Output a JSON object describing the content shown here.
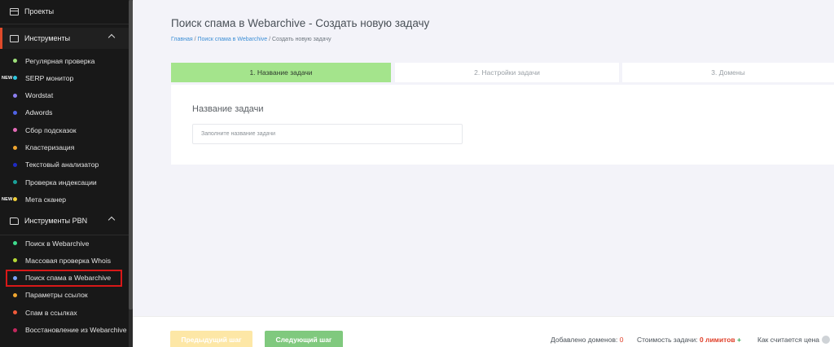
{
  "sidebar": {
    "top_item": "Проекты",
    "sections": [
      {
        "label": "Инструменты"
      },
      {
        "label": "Инструменты PBN"
      }
    ],
    "tools": [
      {
        "label": "Регулярная проверка",
        "dot": "#9ee17a",
        "new": ""
      },
      {
        "label": "SERP монитор",
        "dot": "#2ec8e0",
        "new": "NEW"
      },
      {
        "label": "Wordstat",
        "dot": "#8d7ff0",
        "new": ""
      },
      {
        "label": "Adwords",
        "dot": "#4f63e6",
        "new": ""
      },
      {
        "label": "Сбор подсказок",
        "dot": "#e46bb7",
        "new": ""
      },
      {
        "label": "Кластеризация",
        "dot": "#f0a630",
        "new": ""
      },
      {
        "label": "Текстовый анализатор",
        "dot": "#1f2bc4",
        "new": ""
      },
      {
        "label": "Проверка индексации",
        "dot": "#1aa19a",
        "new": ""
      },
      {
        "label": "Мета сканер",
        "dot": "#f2d13a",
        "new": "NEW"
      }
    ],
    "pbn_tools": [
      {
        "label": "Поиск в Webarchive",
        "dot": "#3fdc8d"
      },
      {
        "label": "Массовая проверка Whois",
        "dot": "#b5d936"
      },
      {
        "label": "Поиск спама в Webarchive",
        "dot": "#7aa2f7"
      },
      {
        "label": "Параметры ссылок",
        "dot": "#f0a630"
      },
      {
        "label": "Спам в ссылках",
        "dot": "#f05a3a"
      },
      {
        "label": "Восстановление из Webarchive",
        "dot": "#c4285e"
      }
    ]
  },
  "header": {
    "title": "Поиск спама в Webarchive - Создать новую задачу",
    "breadcrumb": {
      "home": "Главная",
      "sep": " / ",
      "parent": "Поиск спама в Webarchive",
      "current": "Создать новую задачу"
    }
  },
  "tabs": [
    {
      "label": "1. Название задачи"
    },
    {
      "label": "2. Настройки задачи"
    },
    {
      "label": "3. Домены"
    }
  ],
  "form": {
    "label": "Название задачи",
    "placeholder": "Заполните название задачи",
    "value": ""
  },
  "footer": {
    "prev_label": "Предыдущий шаг",
    "next_label": "Следующий шаг",
    "domains_label": "Добавлено доменов: ",
    "domains_value": "0",
    "cost_label": "Стоимость задачи: ",
    "cost_value": "0 лимитов",
    "plus": "+",
    "price_label": "Как считается цена"
  },
  "colors": {
    "sidebar_bg": "#181818",
    "active_tab": "#a4e48c",
    "next_button": "#80c97e",
    "prev_button": "#fde7a6",
    "accent_red": "#e0402a",
    "selected_outline": "#d81818"
  }
}
